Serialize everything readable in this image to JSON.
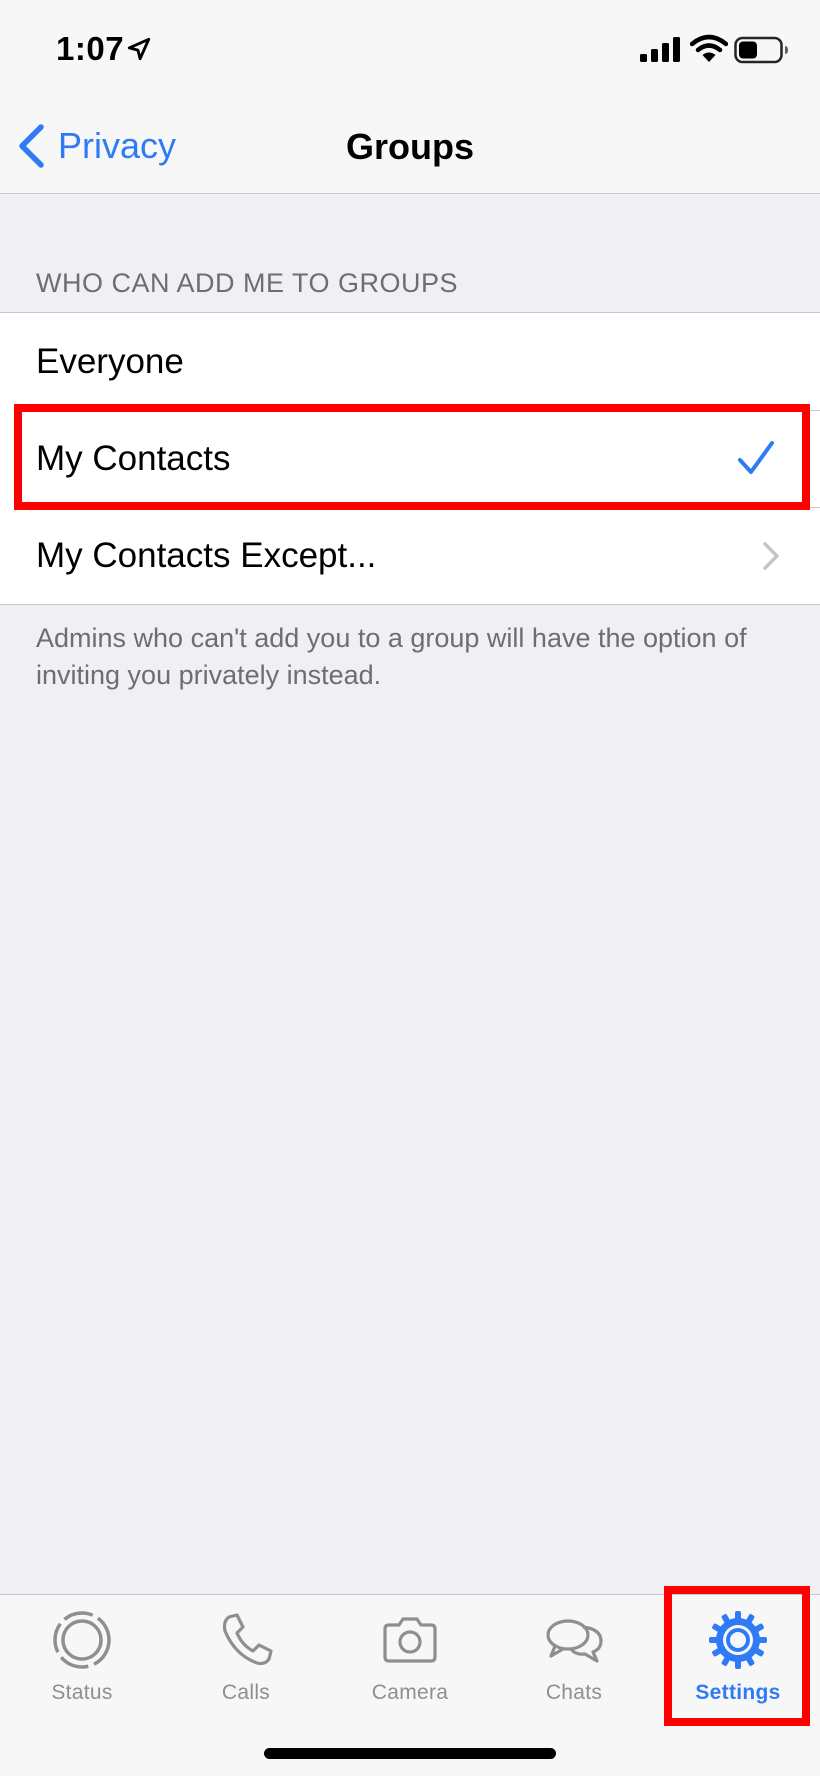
{
  "status_bar": {
    "time": "1:07"
  },
  "nav": {
    "back_label": "Privacy",
    "title": "Groups"
  },
  "section": {
    "header": "WHO CAN ADD ME TO GROUPS"
  },
  "options": [
    {
      "label": "Everyone",
      "selected": false
    },
    {
      "label": "My Contacts",
      "selected": true
    },
    {
      "label": "My Contacts Except...",
      "selected": false
    }
  ],
  "footer_note": "Admins who can't add you to a group will have the option of inviting you privately instead.",
  "tabs": [
    {
      "label": "Status",
      "icon": "status-icon",
      "active": false
    },
    {
      "label": "Calls",
      "icon": "phone-icon",
      "active": false
    },
    {
      "label": "Camera",
      "icon": "camera-icon",
      "active": false
    },
    {
      "label": "Chats",
      "icon": "chat-bubbles-icon",
      "active": false
    },
    {
      "label": "Settings",
      "icon": "gear-icon",
      "active": true
    }
  ],
  "colors": {
    "accent": "#2f7bf5",
    "highlight": "#ff0000",
    "background": "#efeff4"
  }
}
